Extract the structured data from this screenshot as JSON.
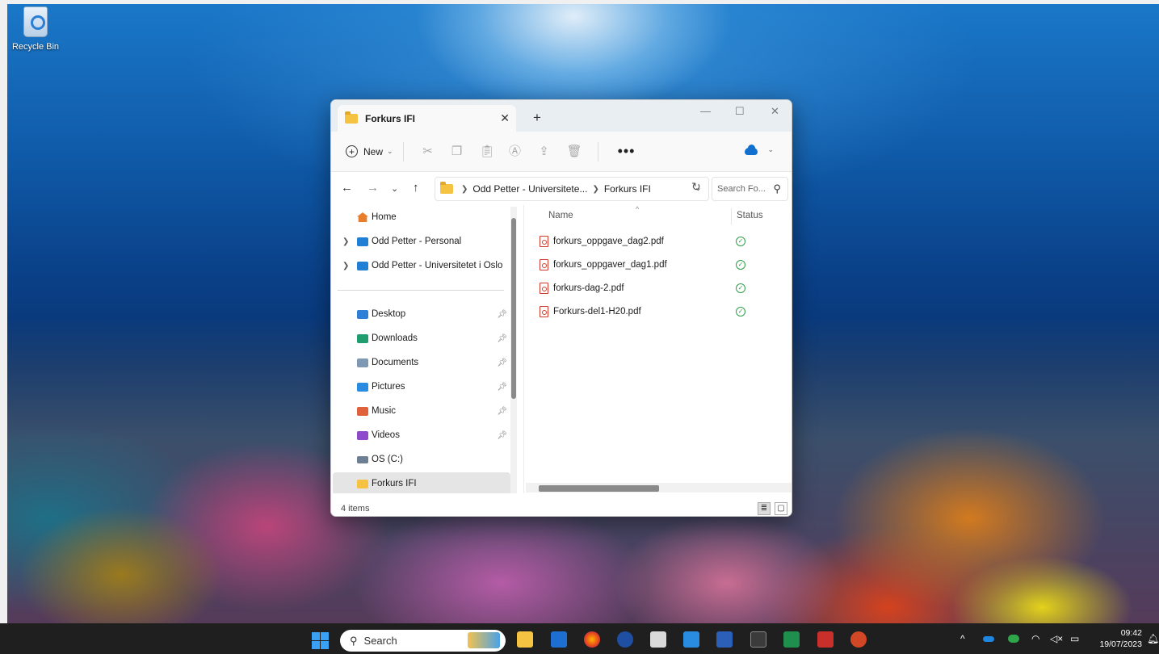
{
  "desktop": {
    "icons": [
      {
        "label": "Recycle Bin",
        "icon": "recycle-bin-icon"
      }
    ]
  },
  "explorer": {
    "tab_title": "Forkurs IFI",
    "new_tab_symbol": "+",
    "close_symbol": "✕",
    "toolbar": {
      "new_label": "New",
      "more_symbol": "•••"
    },
    "address": {
      "crumbs": [
        "Odd Petter - Universitete...",
        "Forkurs IFI"
      ],
      "search_placeholder": "Search Fo..."
    },
    "navigation": {
      "top": [
        {
          "label": "Home",
          "icon": "home-icon"
        },
        {
          "label": "Odd Petter - Personal",
          "icon": "onedrive-folder-icon"
        },
        {
          "label": "Odd Petter - Universitetet i Oslo",
          "icon": "onedrive-folder-icon"
        }
      ],
      "quick_access": [
        {
          "label": "Desktop",
          "icon": "desktop-folder-icon",
          "color": "#2f7fd7"
        },
        {
          "label": "Downloads",
          "icon": "downloads-folder-icon",
          "color": "#1f9d6e"
        },
        {
          "label": "Documents",
          "icon": "documents-folder-icon",
          "color": "#7f98b4"
        },
        {
          "label": "Pictures",
          "icon": "pictures-folder-icon",
          "color": "#2a8ce0"
        },
        {
          "label": "Music",
          "icon": "music-folder-icon",
          "color": "#e0623d"
        },
        {
          "label": "Videos",
          "icon": "videos-folder-icon",
          "color": "#8d49c9"
        },
        {
          "label": "OS (C:)",
          "icon": "drive-icon",
          "color": "#6d7f92"
        },
        {
          "label": "Forkurs IFI",
          "icon": "folder-icon",
          "color": "#f5c242"
        }
      ]
    },
    "columns": {
      "name": "Name",
      "status": "Status"
    },
    "files": [
      {
        "name": "forkurs_oppgave_dag2.pdf",
        "status": "available"
      },
      {
        "name": "forkurs_oppgaver_dag1.pdf",
        "status": "available"
      },
      {
        "name": "forkurs-dag-2.pdf",
        "status": "available"
      },
      {
        "name": "Forkurs-del1-H20.pdf",
        "status": "available"
      }
    ],
    "status_bar": {
      "item_count": "4 items"
    }
  },
  "taskbar": {
    "search_label": "Search",
    "clock_time": "09:42",
    "clock_date": "19/07/2023",
    "accent": "#3aa0f3"
  }
}
